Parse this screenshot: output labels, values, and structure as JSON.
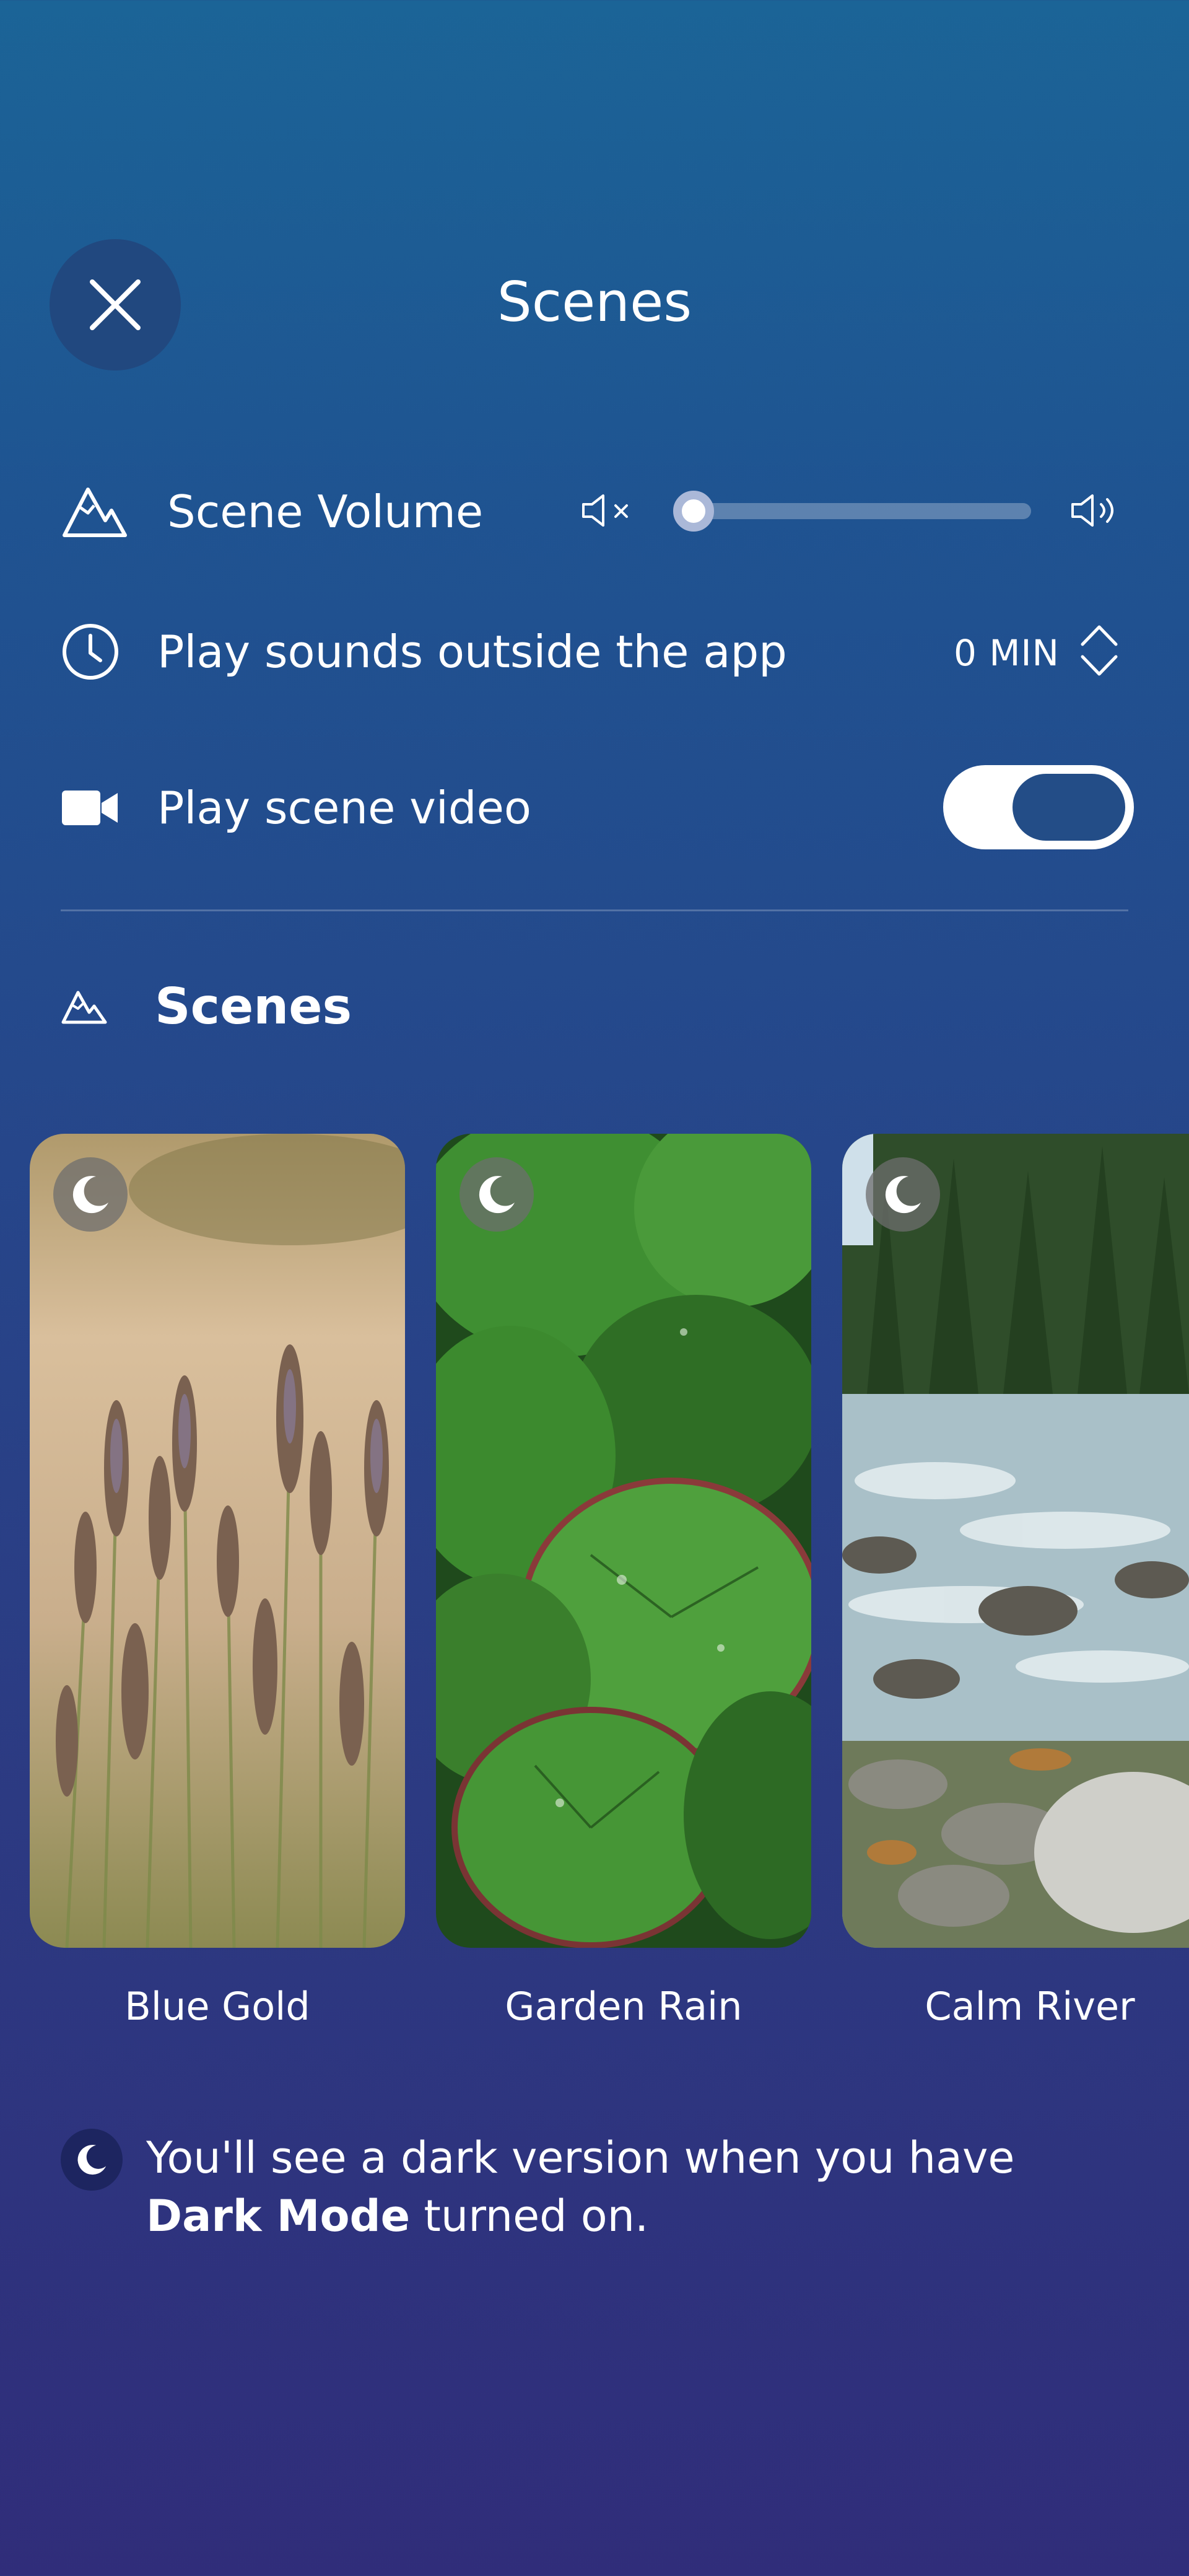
{
  "header": {
    "title": "Scenes",
    "close_icon": "close-icon"
  },
  "settings": {
    "volume": {
      "label": "Scene Volume",
      "level": 0.0,
      "icon": "mountain-icon",
      "mute_icon": "speaker-mute-icon",
      "max_icon": "speaker-loud-icon"
    },
    "outside_app": {
      "label": "Play sounds outside the app",
      "value": "0 MIN",
      "icon": "clock-icon",
      "stepper_icon": "chevron-updown-icon"
    },
    "scene_video": {
      "label": "Play scene video",
      "enabled": true,
      "icon": "video-camera-icon"
    }
  },
  "scenes_section": {
    "title": "Scenes",
    "icon": "mountain-icon",
    "items": [
      {
        "name": "Blue Gold",
        "badge_icon": "moon-icon"
      },
      {
        "name": "Garden Rain",
        "badge_icon": "moon-icon"
      },
      {
        "name": "Calm River",
        "badge_icon": "moon-icon"
      }
    ]
  },
  "note": {
    "text_before": "You'll see a dark version when you have ",
    "bold": "Dark Mode",
    "text_after": " turned on.",
    "icon": "moon-icon"
  },
  "colors": {
    "toggle_on": "#234d87",
    "close_button_bg": "#21487f",
    "accent_white": "#ffffff"
  }
}
